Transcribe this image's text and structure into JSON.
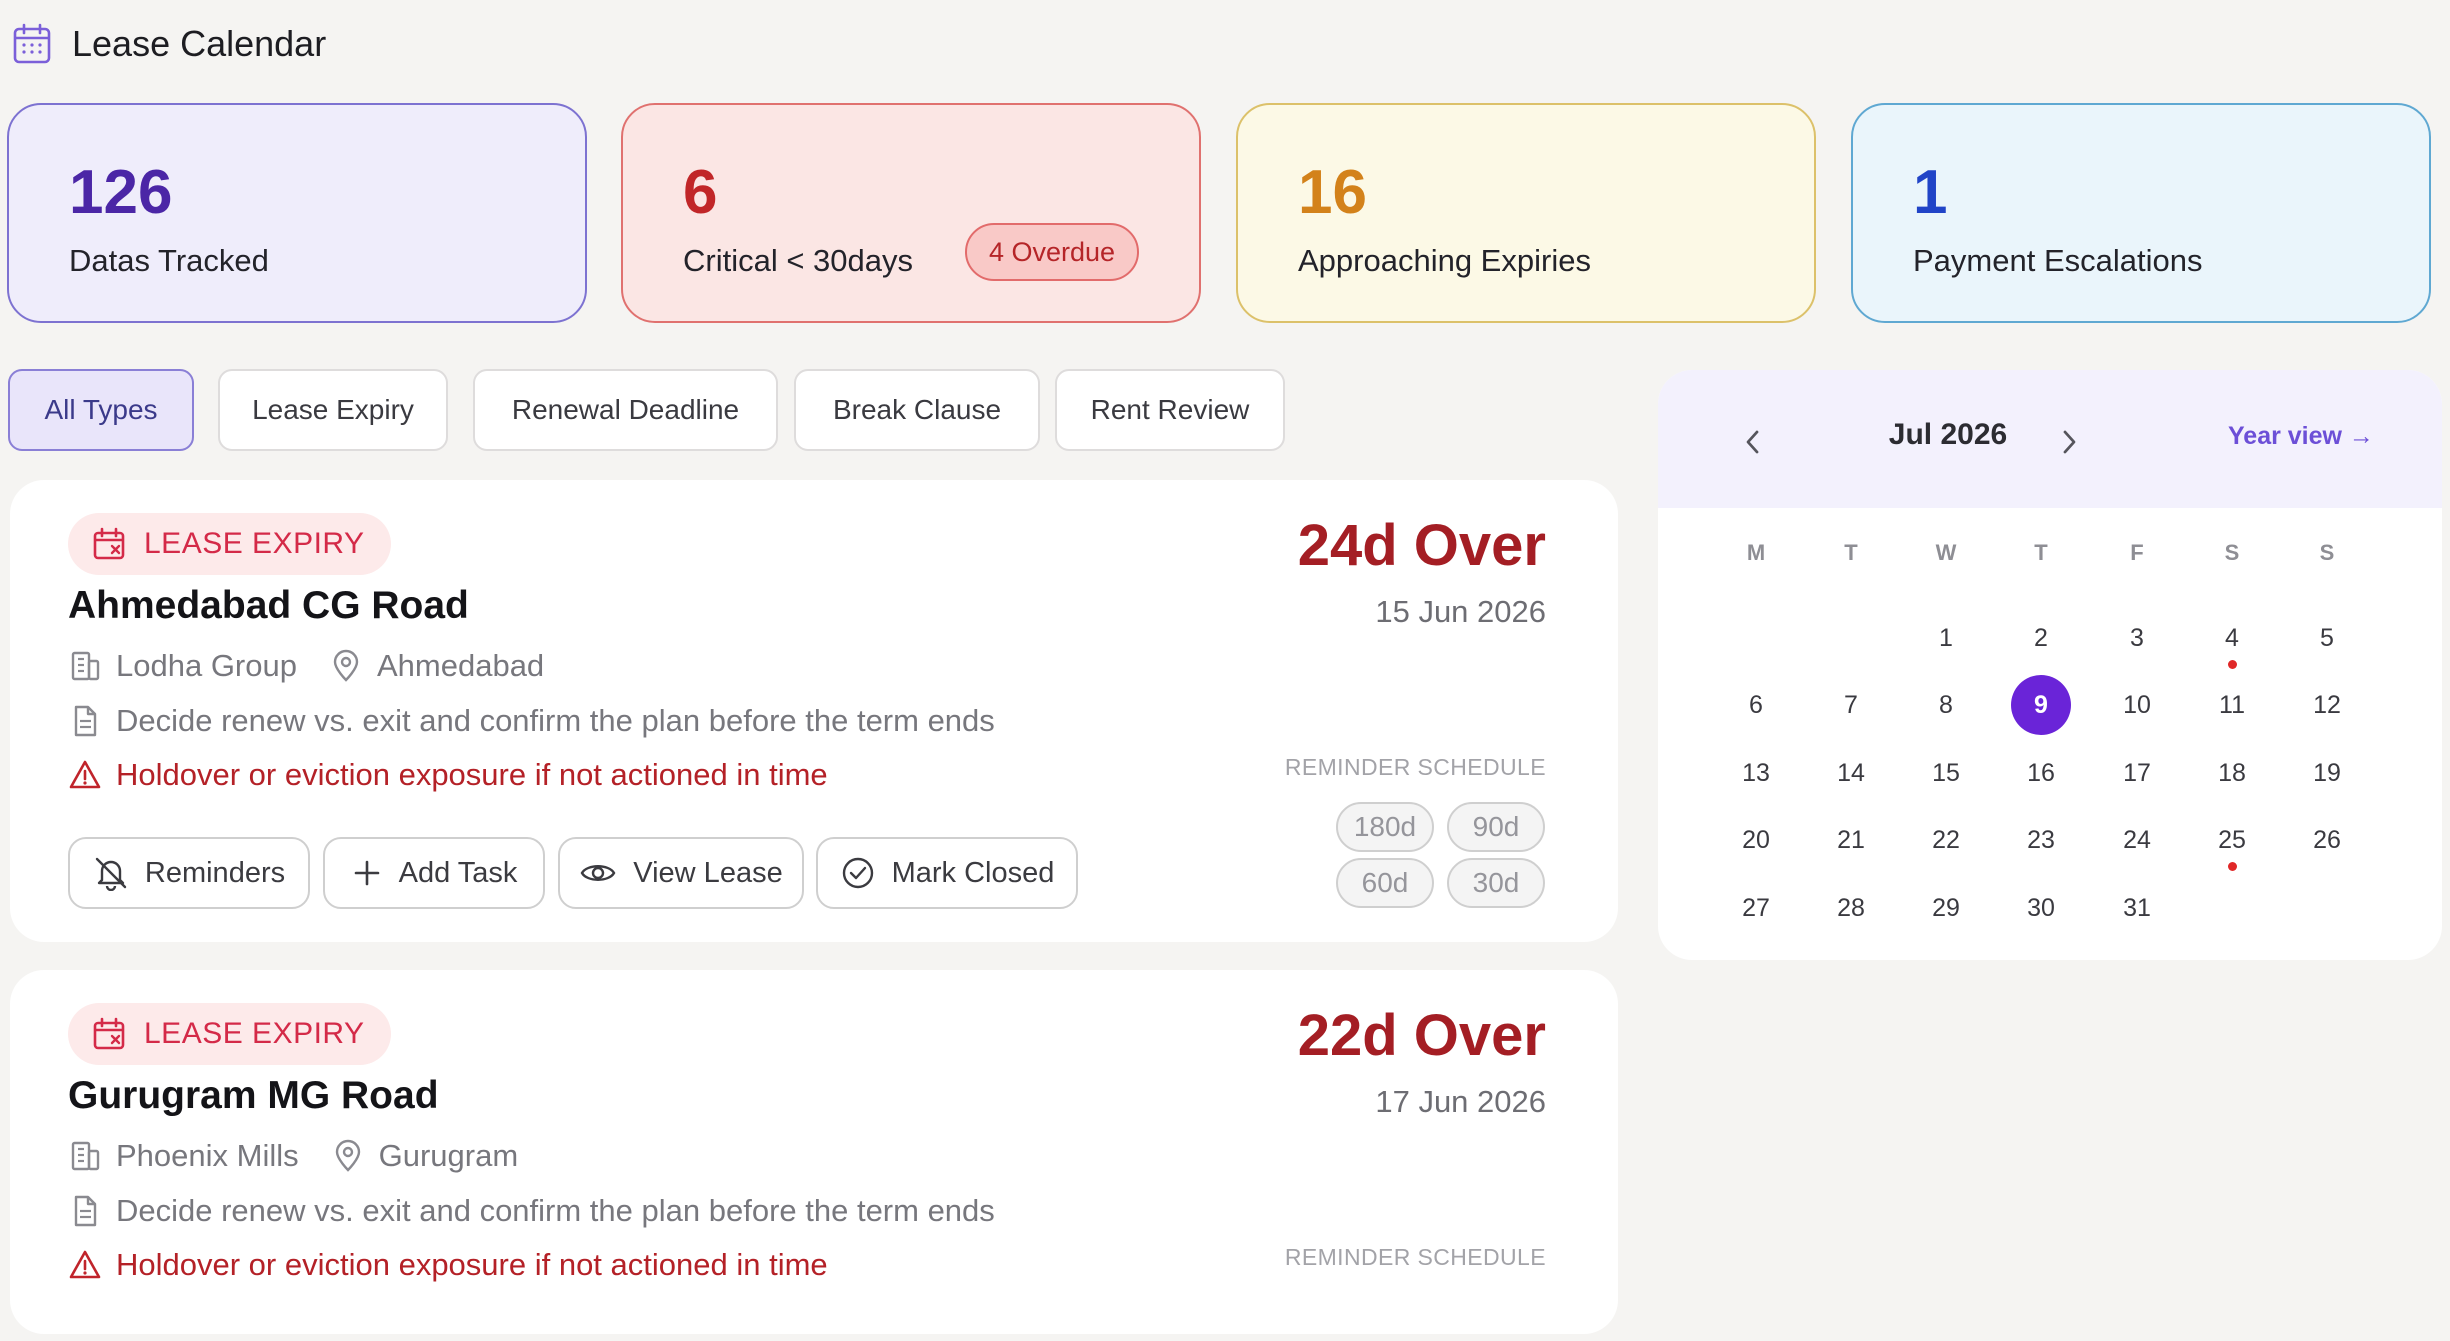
{
  "header": {
    "title": "Lease Calendar",
    "icon": "calendar-icon",
    "icon_color": "#7b5fd9"
  },
  "stats": [
    {
      "value": "126",
      "label": "Datas Tracked",
      "color": "#4b26a6"
    },
    {
      "value": "6",
      "label": "Critical < 30days",
      "badge": "4 Overdue",
      "color": "#c12628"
    },
    {
      "value": "16",
      "label": "Approaching Expiries",
      "color": "#d3821a"
    },
    {
      "value": "1",
      "label": "Payment Escalations",
      "color": "#2144c7"
    }
  ],
  "filters": [
    {
      "label": "All Types",
      "active": true
    },
    {
      "label": "Lease Expiry",
      "active": false
    },
    {
      "label": "Renewal Deadline",
      "active": false
    },
    {
      "label": "Break Clause",
      "active": false
    },
    {
      "label": "Rent Review",
      "active": false
    }
  ],
  "leases": [
    {
      "tag": "LEASE EXPIRY",
      "name": "Ahmedabad CG Road",
      "owner": "Lodha Group",
      "city": "Ahmedabad",
      "description": "Decide renew vs. exit and confirm the plan before the term ends",
      "risk": "Holdover or eviction exposure if not actioned in time",
      "status": "24d Over",
      "date": "15 Jun 2026",
      "reminder_label": "REMINDER SCHEDULE",
      "reminders": [
        "180d",
        "90d",
        "60d",
        "30d"
      ],
      "actions": [
        "Reminders",
        "Add Task",
        "View Lease",
        "Mark Closed"
      ]
    },
    {
      "tag": "LEASE EXPIRY",
      "name": "Gurugram MG Road",
      "owner": "Phoenix Mills",
      "city": "Gurugram",
      "description": "Decide renew vs. exit and confirm the plan before the term ends",
      "risk": "Holdover or eviction exposure if not actioned in time",
      "status": "22d Over",
      "date": "17 Jun 2026",
      "reminder_label": "REMINDER SCHEDULE"
    }
  ],
  "calendar": {
    "month": "Jul 2026",
    "year_view": "Year view →",
    "weekdays": [
      "M",
      "T",
      "W",
      "T",
      "F",
      "S",
      "S"
    ],
    "weeks": [
      [
        "",
        "",
        "1",
        "2",
        "3",
        "4",
        "5"
      ],
      [
        "6",
        "7",
        "8",
        "9",
        "10",
        "11",
        "12"
      ],
      [
        "13",
        "14",
        "15",
        "16",
        "17",
        "18",
        "19"
      ],
      [
        "20",
        "21",
        "22",
        "23",
        "24",
        "25",
        "26"
      ],
      [
        "27",
        "28",
        "29",
        "30",
        "31",
        "",
        ""
      ]
    ],
    "today": "9",
    "event_days": [
      "4",
      "25"
    ],
    "accent": "#6a24d8"
  }
}
